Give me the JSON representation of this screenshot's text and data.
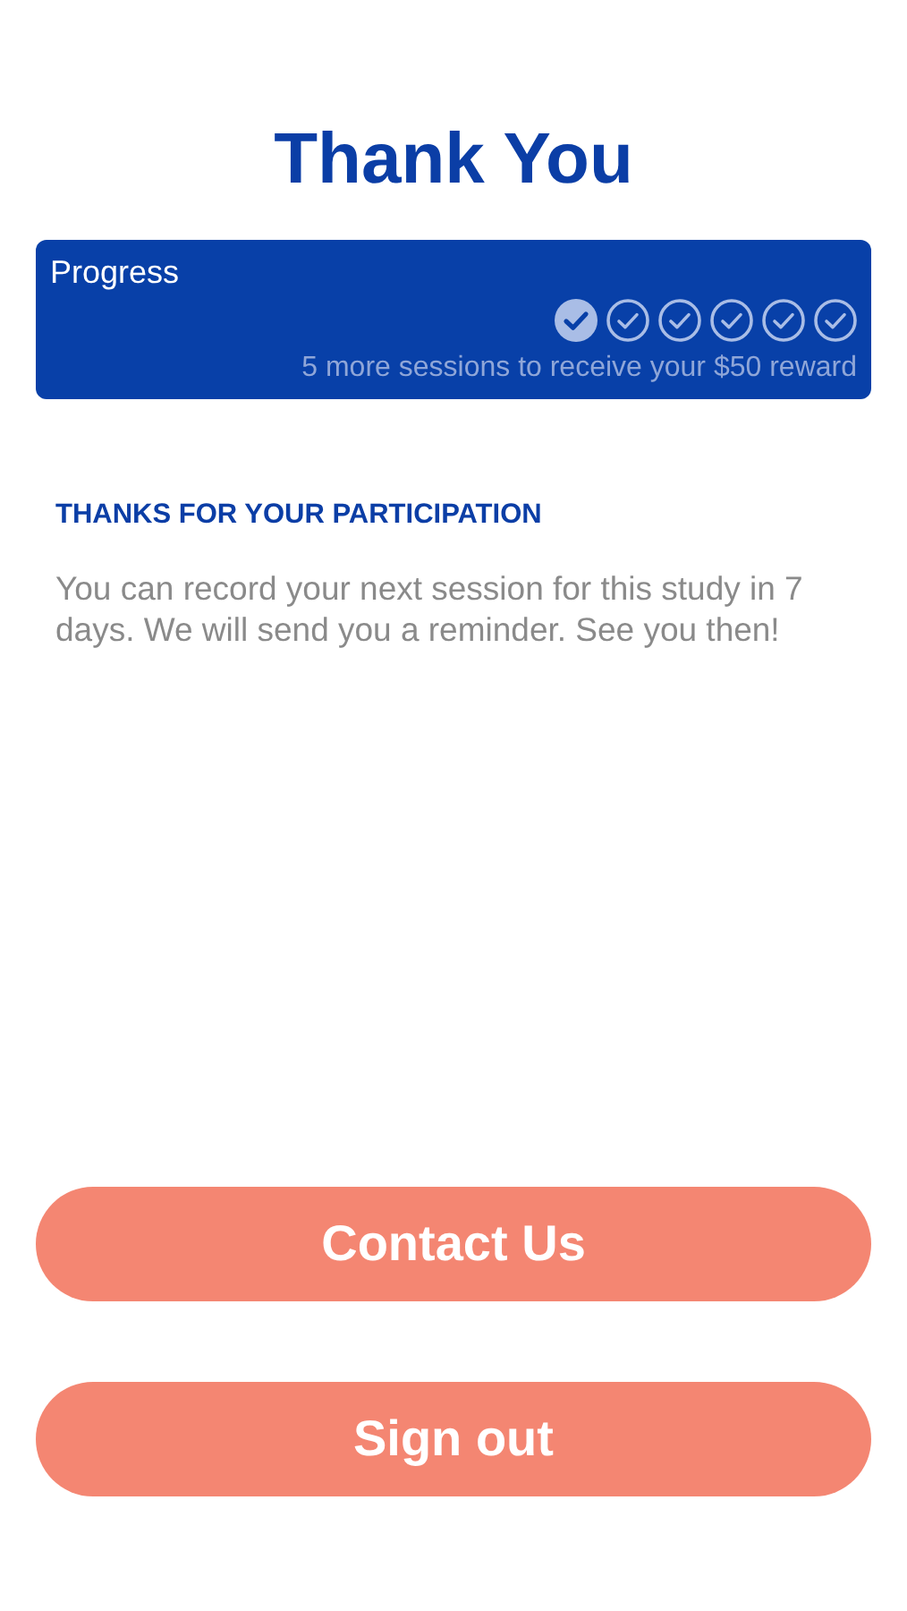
{
  "title": "Thank You",
  "progress": {
    "label": "Progress",
    "sessions": [
      {
        "completed": true
      },
      {
        "completed": false
      },
      {
        "completed": false
      },
      {
        "completed": false
      },
      {
        "completed": false
      },
      {
        "completed": false
      }
    ],
    "caption": "5 more sessions to receive your $50 reward"
  },
  "message": {
    "heading": "THANKS FOR YOUR PARTICIPATION",
    "body": "You can record your next session for this study in 7 days. We will send you a reminder. See you then!"
  },
  "buttons": [
    "Contact Us",
    "Sign out"
  ]
}
